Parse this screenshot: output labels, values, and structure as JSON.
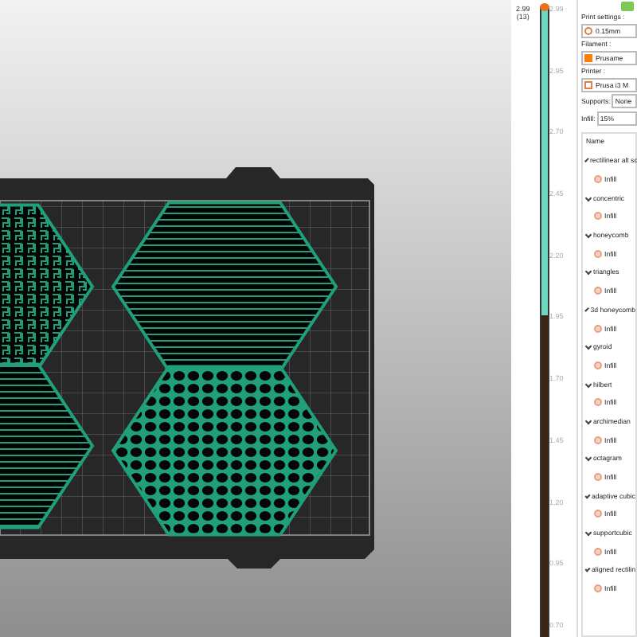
{
  "layer_slider": {
    "level": 1,
    "top_label": "2.99",
    "top_sublabel": "(13)",
    "ticks": [
      "2.99",
      "2.95",
      "2.70",
      "2.45",
      "2.20",
      "1.95",
      "1.70",
      "1.45",
      "1.20",
      "0.95",
      "0.70"
    ]
  },
  "sidebar": {
    "print_settings": {
      "label": "Print settings :",
      "value": "0.15mm"
    },
    "filament": {
      "label": "Filament :",
      "value": "Prusame",
      "color": "#ff7f00"
    },
    "printer": {
      "label": "Printer :",
      "value": "Prusa i3 M"
    },
    "supports": {
      "label": "Supports:",
      "value": "None"
    },
    "infill": {
      "label": "Infill:",
      "value": "15%"
    },
    "object_list": {
      "header": "Name",
      "items": [
        {
          "name": "rectilinear alt sc",
          "expanded": true,
          "children": [
            {
              "name": "Infill"
            }
          ]
        },
        {
          "name": "concentric",
          "expanded": true,
          "children": [
            {
              "name": "Infill"
            }
          ]
        },
        {
          "name": "honeycomb",
          "expanded": true,
          "children": [
            {
              "name": "Infill"
            }
          ]
        },
        {
          "name": "triangles",
          "expanded": true,
          "children": [
            {
              "name": "Infill"
            }
          ]
        },
        {
          "name": "3d honeycomb",
          "expanded": true,
          "children": [
            {
              "name": "Infill"
            }
          ]
        },
        {
          "name": "gyroid",
          "expanded": true,
          "children": [
            {
              "name": "Infill"
            }
          ]
        },
        {
          "name": "hilbert",
          "expanded": true,
          "children": [
            {
              "name": "Infill"
            }
          ]
        },
        {
          "name": "archimedian",
          "expanded": true,
          "children": [
            {
              "name": "Infill"
            }
          ]
        },
        {
          "name": "octagram",
          "expanded": true,
          "children": [
            {
              "name": "Infill"
            }
          ]
        },
        {
          "name": "adaptive cubic",
          "expanded": true,
          "children": [
            {
              "name": "Infill"
            }
          ]
        },
        {
          "name": "supportcubic",
          "expanded": true,
          "children": [
            {
              "name": "Infill"
            }
          ]
        },
        {
          "name": "aligned rectilin",
          "expanded": true,
          "children": [
            {
              "name": "Infill"
            }
          ]
        }
      ]
    }
  }
}
